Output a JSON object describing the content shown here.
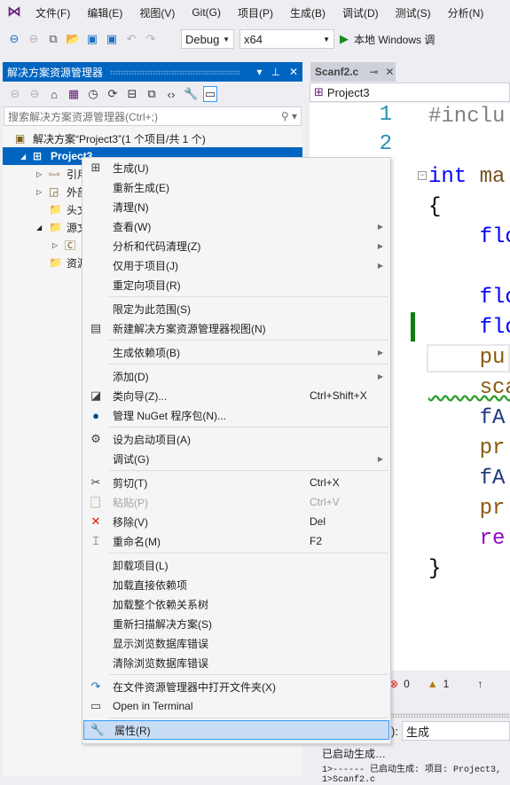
{
  "menubar": {
    "items": [
      "文件(F)",
      "编辑(E)",
      "视图(V)",
      "Git(G)",
      "项目(P)",
      "生成(B)",
      "调试(D)",
      "测试(S)",
      "分析(N)"
    ]
  },
  "toolbar": {
    "config": "Debug",
    "platform": "x64",
    "run_label": "本地 Windows 调"
  },
  "solution_explorer": {
    "title": "解决方案资源管理器",
    "search_placeholder": "搜索解决方案资源管理器(Ctrl+;)",
    "tree": [
      {
        "label": "解决方案“Project3”(1 个项目/共 1 个)",
        "icon": "solution-icon"
      },
      {
        "label": "Project3",
        "icon": "project-icon",
        "selected": true
      },
      {
        "label": "引用",
        "icon": "references-icon"
      },
      {
        "label": "外部",
        "icon": "external-deps-icon"
      },
      {
        "label": "头文",
        "icon": "filter-folder-icon"
      },
      {
        "label": "源文",
        "icon": "filter-folder-icon"
      },
      {
        "label": "",
        "icon": "c-file-icon"
      },
      {
        "label": "资源",
        "icon": "filter-folder-icon"
      }
    ]
  },
  "editor": {
    "tab": "Scanf2.c",
    "nav_project": "Project3",
    "line_numbers": [
      "1",
      "2"
    ],
    "lines": [
      {
        "t": "#inclu",
        "c": "#808080"
      },
      {
        "t": "",
        "c": "#000"
      },
      {
        "t": "int",
        "c": "#0000ff",
        "t2": " ma",
        "c2": "#74531f"
      },
      {
        "t": "{",
        "c": "#000"
      },
      {
        "t": "    flo",
        "c": "#0000ff"
      },
      {
        "t": "",
        "c": "#000"
      },
      {
        "t": "    flo",
        "c": "#0000ff"
      },
      {
        "t": "    flo",
        "c": "#0000ff"
      },
      {
        "t": "    pu",
        "c": "#8a5a10"
      },
      {
        "t": "    sca",
        "c": "#8a5a10"
      },
      {
        "t": "    fA",
        "c": "#1f377f"
      },
      {
        "t": "    pr",
        "c": "#8a5a10"
      },
      {
        "t": "    fA",
        "c": "#1f377f"
      },
      {
        "t": "    pr",
        "c": "#8a5a10"
      },
      {
        "t": "    re",
        "c": "#8f08c4"
      },
      {
        "t": "}",
        "c": "#000"
      }
    ]
  },
  "error_list": {
    "errors": "0",
    "warnings": "1"
  },
  "output": {
    "source_label": "):",
    "source": "生成",
    "lines": [
      "已启动生成…",
      "1>------ 已启动生成: 项目: Project3,",
      "1>Scanf2.c"
    ]
  },
  "context_menu": [
    {
      "label": "生成(U)",
      "icon": "build-icon",
      "glyph": "⊞"
    },
    {
      "label": "重新生成(E)"
    },
    {
      "label": "清理(N)"
    },
    {
      "label": "查看(W)",
      "sub": true
    },
    {
      "label": "分析和代码清理(Z)",
      "sub": true
    },
    {
      "label": "仅用于项目(J)",
      "sub": true
    },
    {
      "label": "重定向项目(R)"
    },
    {
      "sep": true
    },
    {
      "label": "限定为此范围(S)"
    },
    {
      "label": "新建解决方案资源管理器视图(N)",
      "icon": "new-view-icon",
      "glyph": "▤"
    },
    {
      "sep": true
    },
    {
      "label": "生成依赖项(B)",
      "sub": true
    },
    {
      "sep": true
    },
    {
      "label": "添加(D)",
      "sub": true
    },
    {
      "label": "类向导(Z)...",
      "icon": "class-wizard-icon",
      "glyph": "◪",
      "shortcut": "Ctrl+Shift+X"
    },
    {
      "label": "管理 NuGet 程序包(N)...",
      "icon": "nuget-icon",
      "glyph": "●",
      "color": "#004880"
    },
    {
      "sep": true
    },
    {
      "label": "设为启动项目(A)",
      "icon": "gear-icon",
      "glyph": "⚙"
    },
    {
      "label": "调试(G)",
      "sub": true
    },
    {
      "sep": true
    },
    {
      "label": "剪切(T)",
      "icon": "scissors-icon",
      "glyph": "✂",
      "shortcut": "Ctrl+X"
    },
    {
      "label": "粘贴(P)",
      "icon": "paste-icon",
      "glyph": "📋",
      "shortcut": "Ctrl+V",
      "disabled": true
    },
    {
      "label": "移除(V)",
      "icon": "remove-icon",
      "glyph": "✕",
      "color": "#e51400",
      "shortcut": "Del"
    },
    {
      "label": "重命名(M)",
      "icon": "rename-icon",
      "glyph": "⌶",
      "shortcut": "F2"
    },
    {
      "sep": true
    },
    {
      "label": "卸载项目(L)"
    },
    {
      "label": "加载直接依赖项"
    },
    {
      "label": "加载整个依赖关系树"
    },
    {
      "label": "重新扫描解决方案(S)"
    },
    {
      "label": "显示浏览数据库错误"
    },
    {
      "label": "清除浏览数据库错误"
    },
    {
      "sep": true
    },
    {
      "label": "在文件资源管理器中打开文件夹(X)",
      "icon": "open-folder-icon",
      "glyph": "↷",
      "color": "#1e6fc1"
    },
    {
      "label": "Open in Terminal",
      "icon": "terminal-icon",
      "glyph": "▭"
    },
    {
      "sep": true
    },
    {
      "label": "属性(R)",
      "icon": "wrench-icon",
      "glyph": "🔧",
      "highlighted": true
    }
  ],
  "colors": {
    "accent": "#0065c0",
    "highlight": "#c9def5"
  }
}
